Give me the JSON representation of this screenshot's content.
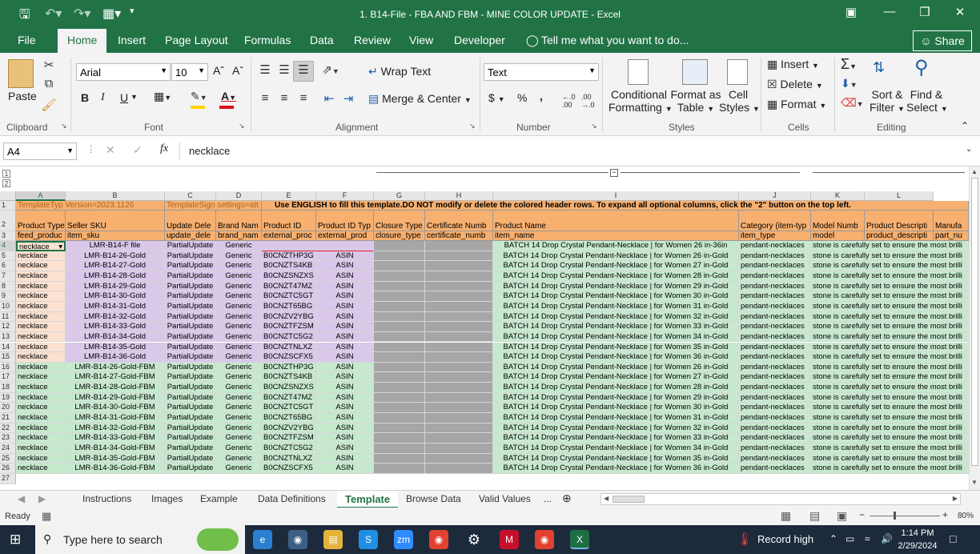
{
  "window": {
    "title": "1. B14-File - FBA AND FBM - MINE COLOR UPDATE - Excel"
  },
  "menu": {
    "tabs": [
      "File",
      "Home",
      "Insert",
      "Page Layout",
      "Formulas",
      "Data",
      "Review",
      "View",
      "Developer"
    ],
    "tell_me": "Tell me what you want to do...",
    "share": "Share"
  },
  "ribbon": {
    "paste": "Paste",
    "font_name": "Arial",
    "font_size": "10",
    "bold": "B",
    "italic": "I",
    "underline": "U",
    "wrap_text": "Wrap Text",
    "merge_center": "Merge & Center",
    "number_format": "Text",
    "currency": "$",
    "percent": "%",
    "comma": ",",
    "cond_format": [
      "Conditional",
      "Formatting"
    ],
    "format_table": [
      "Format as",
      "Table"
    ],
    "cell_styles": [
      "Cell",
      "Styles"
    ],
    "insert": "Insert",
    "delete": "Delete",
    "format": "Format",
    "sort_filter": [
      "Sort &",
      "Filter"
    ],
    "find_select": [
      "Find &",
      "Select"
    ],
    "groups": [
      "Clipboard",
      "Font",
      "Alignment",
      "Number",
      "Styles",
      "Cells",
      "Editing"
    ]
  },
  "formula_bar": {
    "name_box": "A4",
    "fx": "fx",
    "value": "necklace"
  },
  "grid": {
    "columns": [
      "A",
      "B",
      "C",
      "D",
      "E",
      "F",
      "G",
      "H",
      "I",
      "J",
      "K",
      "L"
    ],
    "row1_a": "TemplateTyp Version=2023.1126",
    "row1_c": "TemplateSign settings=att",
    "row1_e": "Use ENGLISH to fill this template.DO NOT modify or delete the colored header rows. To expand all optional columns, click the \"2\" button on the top left.",
    "row2": [
      "Product Type",
      "Seller SKU",
      "Update Dele",
      "Brand Nam",
      "Product ID",
      "Product ID Typ",
      "Closure Type",
      "Certificate Numb",
      "Product Name",
      "Category (item-typ",
      "Model Numb",
      "Product Descripti",
      "Manufa"
    ],
    "row3": [
      "feed_produc",
      "item_sku",
      "update_dele",
      "brand_nam",
      "external_proc",
      "external_prod",
      "closure_type",
      "certificate_numb",
      "item_name",
      "item_type",
      "model",
      "product_descripti",
      "part_nu"
    ],
    "row4": {
      "a": "necklace",
      "b": "LMR-B14-F file",
      "c": "PartialUpdate",
      "d": "Generic",
      "i": "BATCH 14 Drop Crystal Pendant-Necklace | for Women 26 in-36in",
      "j": "pendant-necklaces",
      "l": "stone is carefully set to ensure the most brilli"
    },
    "rows": [
      {
        "sku": "LMR-B14-26-Gold",
        "asin": "B0CNZTHP3G",
        "name": "BATCH 14 Drop Crystal Pendant-Necklace | for Women 26 in-Gold"
      },
      {
        "sku": "LMR-B14-27-Gold",
        "asin": "B0CNZTS4KB",
        "name": "BATCH 14 Drop Crystal Pendant-Necklace | for Women 27 in-Gold"
      },
      {
        "sku": "LMR-B14-28-Gold",
        "asin": "B0CNZSNZXS",
        "name": "BATCH 14 Drop Crystal Pendant-Necklace | for Women 28 in-Gold"
      },
      {
        "sku": "LMR-B14-29-Gold",
        "asin": "B0CNZT47MZ",
        "name": "BATCH 14 Drop Crystal Pendant-Necklace | for Women 29 in-Gold"
      },
      {
        "sku": "LMR-B14-30-Gold",
        "asin": "B0CNZTC5GT",
        "name": "BATCH 14 Drop Crystal Pendant-Necklace | for Women 30 in-Gold"
      },
      {
        "sku": "LMR-B14-31-Gold",
        "asin": "B0CNZT65BG",
        "name": "BATCH 14 Drop Crystal Pendant-Necklace | for Women 31 in-Gold"
      },
      {
        "sku": "LMR-B14-32-Gold",
        "asin": "B0CNZV2YBG",
        "name": "BATCH 14 Drop Crystal Pendant-Necklace | for Women 32 in-Gold"
      },
      {
        "sku": "LMR-B14-33-Gold",
        "asin": "B0CNZTFZSM",
        "name": "BATCH 14 Drop Crystal Pendant-Necklace | for Women 33 in-Gold"
      },
      {
        "sku": "LMR-B14-34-Gold",
        "asin": "B0CNZTC5G2",
        "name": "BATCH 14 Drop Crystal Pendant-Necklace | for Women 34 in-Gold"
      },
      {
        "sku": "LMR-B14-35-Gold",
        "asin": "B0CNZTNLXZ",
        "name": "BATCH 14 Drop Crystal Pendant-Necklace | for Women 35 in-Gold"
      },
      {
        "sku": "LMR-B14-36-Gold",
        "asin": "B0CNZSCFX5",
        "name": "BATCH 14 Drop Crystal Pendant-Necklace | for Women 36 in-Gold"
      },
      {
        "sku": "LMR-B14-26-Gold-FBM",
        "asin": "B0CNZTHP3G",
        "name": "BATCH 14 Drop Crystal Pendant-Necklace | for Women 26 in-Gold"
      },
      {
        "sku": "LMR-B14-27-Gold-FBM",
        "asin": "B0CNZTS4KB",
        "name": "BATCH 14 Drop Crystal Pendant-Necklace | for Women 27 in-Gold"
      },
      {
        "sku": "LMR-B14-28-Gold-FBM",
        "asin": "B0CNZSNZXS",
        "name": "BATCH 14 Drop Crystal Pendant-Necklace | for Women 28 in-Gold"
      },
      {
        "sku": "LMR-B14-29-Gold-FBM",
        "asin": "B0CNZT47MZ",
        "name": "BATCH 14 Drop Crystal Pendant-Necklace | for Women 29 in-Gold"
      },
      {
        "sku": "LMR-B14-30-Gold-FBM",
        "asin": "B0CNZTC5GT",
        "name": "BATCH 14 Drop Crystal Pendant-Necklace | for Women 30 in-Gold"
      },
      {
        "sku": "LMR-B14-31-Gold-FBM",
        "asin": "B0CNZT65BG",
        "name": "BATCH 14 Drop Crystal Pendant-Necklace | for Women 31 in-Gold"
      },
      {
        "sku": "LMR-B14-32-Gold-FBM",
        "asin": "B0CNZV2YBG",
        "name": "BATCH 14 Drop Crystal Pendant-Necklace | for Women 32 in-Gold"
      },
      {
        "sku": "LMR-B14-33-Gold-FBM",
        "asin": "B0CNZTFZSM",
        "name": "BATCH 14 Drop Crystal Pendant-Necklace | for Women 33 in-Gold"
      },
      {
        "sku": "LMR-B14-34-Gold-FBM",
        "asin": "B0CNZTC5G2",
        "name": "BATCH 14 Drop Crystal Pendant-Necklace | for Women 34 in-Gold"
      },
      {
        "sku": "LMR-B14-35-Gold-FBM",
        "asin": "B0CNZTNLXZ",
        "name": "BATCH 14 Drop Crystal Pendant-Necklace | for Women 35 in-Gold"
      },
      {
        "sku": "LMR-B14-36-Gold-FBM",
        "asin": "B0CNZSCFX5",
        "name": "BATCH 14 Drop Crystal Pendant-Necklace | for Women 36 in-Gold"
      }
    ],
    "common": {
      "product_type": "necklace",
      "update": "PartialUpdate",
      "brand": "Generic",
      "id_type": "ASIN",
      "category": "pendant-necklaces",
      "description": "stone is carefully set to ensure the most brilli"
    }
  },
  "sheet_tabs": [
    "Instructions",
    "Images",
    "Example",
    "Data Definitions",
    "Template",
    "Browse Data",
    "Valid Values"
  ],
  "active_sheet": "Template",
  "status": {
    "ready": "Ready",
    "zoom": "80%"
  },
  "taskbar": {
    "search": "Type here to search",
    "record": "Record high",
    "time": "1:14 PM",
    "date": "2/29/2024"
  },
  "colors": {
    "excel_green": "#217346",
    "header_orange": "#f7b070",
    "lavender": "#d9c8ea",
    "mint": "#c6e9ce",
    "gray": "#a6a6a6"
  }
}
